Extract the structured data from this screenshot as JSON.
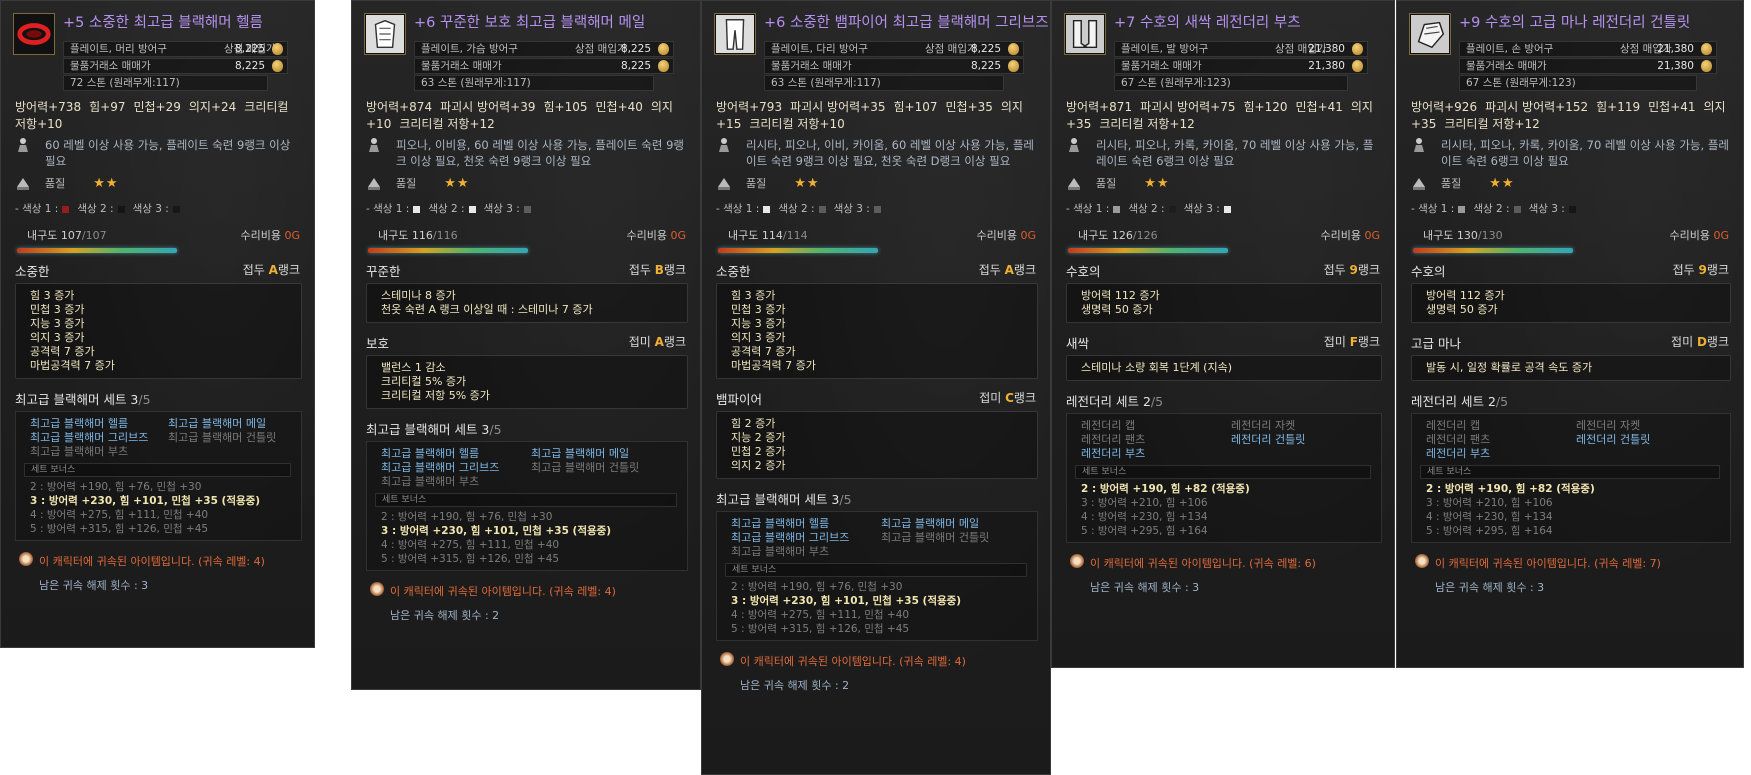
{
  "colors": {
    "purple": "#b48ff0",
    "gold": "#f0b030",
    "red": "#e05a2a",
    "blue_link": "#7fb8e6"
  },
  "panels": [
    {
      "icon": "helmet-icon",
      "name": "+5 소중한 최고급 블랙해머 헬름",
      "type": "플레이트, 머리 방어구",
      "shop_label": "상점 매입가",
      "shop_price": "8,225",
      "trade_label": "물품거래소 매매가",
      "trade_price": "8,225",
      "weight": "72 스톤 (원래무게:117)",
      "stats": [
        "방어력+738",
        "힘+97",
        "민첩+29",
        "의지+24",
        "크리티컬 저항+10"
      ],
      "req": "60 레벨 이상 사용 가능, 플레이트 숙련 9랭크 이상 필요",
      "grade_label": "품질",
      "stars": "★★",
      "colors_text": [
        "- 색상 1 :",
        "색상 2 :",
        "색상 3 :"
      ],
      "color_values": [
        "#9a1a1a",
        "#111111",
        "#111111"
      ],
      "durability_label": "내구도",
      "durability": "107",
      "durability_max": "/107",
      "durability_pct": 1.0,
      "repair_label": "수리비용",
      "repair_cost": "0G",
      "sections": [
        {
          "title": "소중한",
          "rank_label": "접두",
          "rank": "A",
          "rank_suffix": "랭크",
          "rank_color": "#f0b030",
          "lines": [
            "힘 3 증가",
            "민첩 3 증가",
            "지능 3 증가",
            "의지 3 증가",
            "공격력 7 증가",
            "마법공격력 7 증가"
          ]
        }
      ],
      "set_title": "최고급 블랙해머 세트 3",
      "set_count": "/5",
      "set_items": [
        {
          "label": "최고급 블랙해머 헬름",
          "on": true
        },
        {
          "label": "최고급 블랙해머 메일",
          "on": true
        },
        {
          "label": "최고급 블랙해머 그리브즈",
          "on": true
        },
        {
          "label": "최고급 블랙해머 건틀릿",
          "on": false
        },
        {
          "label": "최고급 블랙해머 부츠",
          "on": false
        }
      ],
      "set_bonus_label": "세트 보너스",
      "bonuses": [
        {
          "text": "2 : 방어력 +190, 힘 +76, 민첩 +30",
          "on": false
        },
        {
          "text": "3 : 방어력 +230, 힘 +101, 민첩 +35 (적용중)",
          "on": true
        },
        {
          "text": "4 : 방어력 +275, 힘 +111, 민첩 +40",
          "on": false
        },
        {
          "text": "5 : 방어력 +315, 힘 +126, 민첩 +45",
          "on": false
        }
      ],
      "bound": "이 캐릭터에 귀속된 아이템입니다. (귀속 레벨: 4)",
      "unbind": "남은 귀속 해제 횟수 : 3"
    },
    {
      "icon": "chest-armor-icon",
      "name": "+6 꾸준한 보호 최고급 블랙해머 메일",
      "type": "플레이트, 가슴 방어구",
      "shop_label": "상점 매입가",
      "shop_price": "8,225",
      "trade_label": "물품거래소 매매가",
      "trade_price": "8,225",
      "weight": "63 스톤 (원래무게:117)",
      "stats": [
        "방어력+874",
        "파괴시 방어력+39",
        "힘+105",
        "민첩+40",
        "의지+10",
        "크리티컬 저항+12"
      ],
      "req": "피오나, 이비용, 60 레벨 이상 사용 가능, 플레이트 숙련 9랭크 이상 필요, 천옷 숙련 9랭크 이상 필요",
      "grade_label": "품질",
      "stars": "★★",
      "colors_text": [
        "- 색상 1 :",
        "색상 2 :",
        "색상 3 :"
      ],
      "color_values": [
        "#e8e8e8",
        "#e8e8e8",
        "#5a5a5a"
      ],
      "durability_label": "내구도",
      "durability": "116",
      "durability_max": "/116",
      "durability_pct": 1.0,
      "repair_label": "수리비용",
      "repair_cost": "0G",
      "sections": [
        {
          "title": "꾸준한",
          "rank_label": "접두",
          "rank": "B",
          "rank_suffix": "랭크",
          "rank_color": "#f0b030",
          "lines": [
            "스테미나 8 증가",
            "천옷 숙련 A 랭크 이상일 때 : 스테미나 7 증가"
          ]
        },
        {
          "title": "보호",
          "rank_label": "접미",
          "rank": "A",
          "rank_suffix": "랭크",
          "rank_color": "#f0b030",
          "lines": [
            "밸런스 1 감소",
            "크리티컬 5% 증가",
            "크리티컬 저항 5% 증가"
          ]
        }
      ],
      "set_title": "최고급 블랙해머 세트 3",
      "set_count": "/5",
      "set_items": [
        {
          "label": "최고급 블랙해머 헬름",
          "on": true
        },
        {
          "label": "최고급 블랙해머 메일",
          "on": true
        },
        {
          "label": "최고급 블랙해머 그리브즈",
          "on": true
        },
        {
          "label": "최고급 블랙해머 건틀릿",
          "on": false
        },
        {
          "label": "최고급 블랙해머 부츠",
          "on": false
        }
      ],
      "set_bonus_label": "세트 보너스",
      "bonuses": [
        {
          "text": "2 : 방어력 +190, 힘 +76, 민첩 +30",
          "on": false
        },
        {
          "text": "3 : 방어력 +230, 힘 +101, 민첩 +35 (적용중)",
          "on": true
        },
        {
          "text": "4 : 방어력 +275, 힘 +111, 민첩 +40",
          "on": false
        },
        {
          "text": "5 : 방어력 +315, 힘 +126, 민첩 +45",
          "on": false
        }
      ],
      "bound": "이 캐릭터에 귀속된 아이템입니다. (귀속 레벨: 4)",
      "unbind": "남은 귀속 해제 횟수 : 2"
    },
    {
      "icon": "greaves-icon",
      "name": "+6 소중한 뱀파이어 최고급 블랙해머 그리브즈",
      "type": "플레이트, 다리 방어구",
      "shop_label": "상점 매입가",
      "shop_price": "8,225",
      "trade_label": "물품거래소 매매가",
      "trade_price": "8,225",
      "weight": "63 스톤 (원래무게:117)",
      "stats": [
        "방어력+793",
        "파괴시 방어력+35",
        "힘+107",
        "민첩+35",
        "의지+15",
        "크리티컬 저항+10"
      ],
      "req": "리시타, 피오나, 이비, 카이움, 60 레벨 이상 사용 가능, 플레이트 숙련 9랭크 이상 필요, 천옷 숙련 D랭크 이상 필요",
      "grade_label": "품질",
      "stars": "★★",
      "colors_text": [
        "- 색상 1 :",
        "색상 2 :",
        "색상 3 :"
      ],
      "color_values": [
        "#e8e8e8",
        "#5a5a5a",
        "#5a5a5a"
      ],
      "durability_label": "내구도",
      "durability": "114",
      "durability_max": "/114",
      "durability_pct": 1.0,
      "repair_label": "수리비용",
      "repair_cost": "0G",
      "sections": [
        {
          "title": "소중한",
          "rank_label": "접두",
          "rank": "A",
          "rank_suffix": "랭크",
          "rank_color": "#f0b030",
          "lines": [
            "힘 3 증가",
            "민첩 3 증가",
            "지능 3 증가",
            "의지 3 증가",
            "공격력 7 증가",
            "마법공격력 7 증가"
          ]
        },
        {
          "title": "뱀파이어",
          "rank_label": "접미",
          "rank": "C",
          "rank_suffix": "랭크",
          "rank_color": "#f0b030",
          "lines": [
            "힘 2 증가",
            "지능 2 증가",
            "민첩 2 증가",
            "의지 2 증가"
          ]
        }
      ],
      "set_title": "최고급 블랙해머 세트 3",
      "set_count": "/5",
      "set_items": [
        {
          "label": "최고급 블랙해머 헬름",
          "on": true
        },
        {
          "label": "최고급 블랙해머 메일",
          "on": true
        },
        {
          "label": "최고급 블랙해머 그리브즈",
          "on": true
        },
        {
          "label": "최고급 블랙해머 건틀릿",
          "on": false
        },
        {
          "label": "최고급 블랙해머 부츠",
          "on": false
        }
      ],
      "set_bonus_label": "세트 보너스",
      "bonuses": [
        {
          "text": "2 : 방어력 +190, 힘 +76, 민첩 +30",
          "on": false
        },
        {
          "text": "3 : 방어력 +230, 힘 +101, 민첩 +35 (적용중)",
          "on": true
        },
        {
          "text": "4 : 방어력 +275, 힘 +111, 민첩 +40",
          "on": false
        },
        {
          "text": "5 : 방어력 +315, 힘 +126, 민첩 +45",
          "on": false
        }
      ],
      "bound": "이 캐릭터에 귀속된 아이템입니다. (귀속 레벨: 4)",
      "unbind": "남은 귀속 해제 횟수 : 2"
    },
    {
      "icon": "boots-icon",
      "name": "+7 수호의 새싹 레전더리 부츠",
      "type": "플레이트, 발 방어구",
      "shop_label": "상점 매입가",
      "shop_price": "21,380",
      "trade_label": "물품거래소 매매가",
      "trade_price": "21,380",
      "weight": "67 스톤 (원래무게:123)",
      "stats": [
        "방어력+871",
        "파괴시 방어력+75",
        "힘+120",
        "민첩+41",
        "의지+35",
        "크리티컬 저항+12"
      ],
      "req": "리시타, 피오나, 카록, 카이움, 70 레벨 이상 사용 가능, 플레이트 숙련 6랭크 이상 필요",
      "grade_label": "품질",
      "stars": "★★",
      "colors_text": [
        "- 색상 1 :",
        "색상 2 :",
        "색상 3 :"
      ],
      "color_values": [
        "#9a9a9a",
        "#1a1a1a",
        "#e8e8e8"
      ],
      "durability_label": "내구도",
      "durability": "126",
      "durability_max": "/126",
      "durability_pct": 1.0,
      "repair_label": "수리비용",
      "repair_cost": "0G",
      "sections": [
        {
          "title": "수호의",
          "rank_label": "접두",
          "rank": "9",
          "rank_suffix": "랭크",
          "rank_color": "#f0b030",
          "lines": [
            "방어력 112 증가",
            "생명력 50 증가"
          ]
        },
        {
          "title": "새싹",
          "rank_label": "접미",
          "rank": "F",
          "rank_suffix": "랭크",
          "rank_color": "#f0b030",
          "lines": [
            "스테미나 소량 회복 1단계 (지속)"
          ]
        }
      ],
      "set_title": "레전더리 세트 2",
      "set_count": "/5",
      "set_items": [
        {
          "label": "레전더리 캡",
          "on": false
        },
        {
          "label": "레전더리 자켓",
          "on": false
        },
        {
          "label": "레전더리 팬츠",
          "on": false
        },
        {
          "label": "레전더리 건틀릿",
          "on": true
        },
        {
          "label": "레전더리 부츠",
          "on": true
        }
      ],
      "set_bonus_label": "세트 보너스",
      "bonuses": [
        {
          "text": "2 : 방어력 +190, 힘 +82 (적용중)",
          "on": true
        },
        {
          "text": "3 : 방어력 +210, 힘 +106",
          "on": false
        },
        {
          "text": "4 : 방어력 +230, 힘 +134",
          "on": false
        },
        {
          "text": "5 : 방어력 +295, 힘 +164",
          "on": false
        }
      ],
      "bound": "이 캐릭터에 귀속된 아이템입니다. (귀속 레벨: 6)",
      "unbind": "남은 귀속 해제 횟수 : 3"
    },
    {
      "icon": "gauntlet-icon",
      "name": "+9 수호의 고급 마나 레전더리 건틀릿",
      "type": "플레이트, 손 방어구",
      "shop_label": "상점 매입가",
      "shop_price": "21,380",
      "trade_label": "물품거래소 매매가",
      "trade_price": "21,380",
      "weight": "67 스톤 (원래무게:123)",
      "stats": [
        "방어력+926",
        "파괴시 방어력+152",
        "힘+119",
        "민첩+41",
        "의지+35",
        "크리티컬 저항+12"
      ],
      "req": "리시타, 피오나, 카록, 카이움, 70 레벨 이상 사용 가능, 플레이트 숙련 6랭크 이상 필요",
      "grade_label": "품질",
      "stars": "★★",
      "colors_text": [
        "- 색상 1 :",
        "색상 2 :",
        "색상 3 :"
      ],
      "color_values": [
        "#9a9a9a",
        "#5a5a5a",
        "#111111"
      ],
      "durability_label": "내구도",
      "durability": "130",
      "durability_max": "/130",
      "durability_pct": 1.0,
      "repair_label": "수리비용",
      "repair_cost": "0G",
      "sections": [
        {
          "title": "수호의",
          "rank_label": "접두",
          "rank": "9",
          "rank_suffix": "랭크",
          "rank_color": "#f0b030",
          "lines": [
            "방어력 112 증가",
            "생명력 50 증가"
          ]
        },
        {
          "title": "고급 마나",
          "rank_label": "접미",
          "rank": "D",
          "rank_suffix": "랭크",
          "rank_color": "#f0b030",
          "lines": [
            "발동 시, 일정 확률로 공격 속도 증가"
          ]
        }
      ],
      "set_title": "레전더리 세트 2",
      "set_count": "/5",
      "set_items": [
        {
          "label": "레전더리 캡",
          "on": false
        },
        {
          "label": "레전더리 자켓",
          "on": false
        },
        {
          "label": "레전더리 팬츠",
          "on": false
        },
        {
          "label": "레전더리 건틀릿",
          "on": true
        },
        {
          "label": "레전더리 부츠",
          "on": true
        }
      ],
      "set_bonus_label": "세트 보너스",
      "bonuses": [
        {
          "text": "2 : 방어력 +190, 힘 +82 (적용중)",
          "on": true
        },
        {
          "text": "3 : 방어력 +210, 힘 +106",
          "on": false
        },
        {
          "text": "4 : 방어력 +230, 힘 +134",
          "on": false
        },
        {
          "text": "5 : 방어력 +295, 힘 +164",
          "on": false
        }
      ],
      "bound": "이 캐릭터에 귀속된 아이템입니다. (귀속 레벨: 7)",
      "unbind": "남은 귀속 해제 횟수 : 3"
    }
  ]
}
